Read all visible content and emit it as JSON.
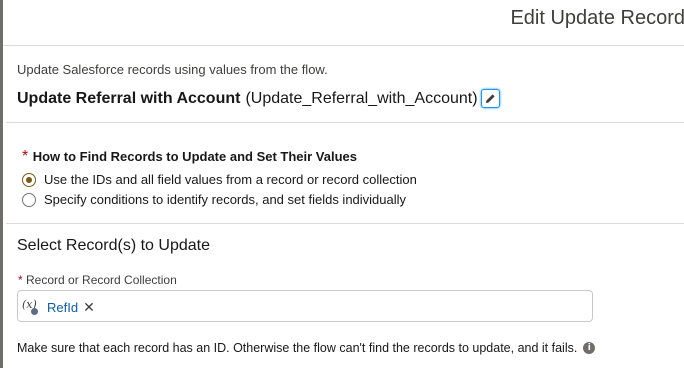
{
  "header": {
    "title": "Edit Update Record"
  },
  "element": {
    "description": "Update Salesforce records using values from the flow.",
    "label": "Update Referral with Account",
    "api_name": "(Update_Referral_with_Account)"
  },
  "find_records": {
    "required_mark": "*",
    "legend": "How to Find Records to Update and Set Their Values",
    "options": [
      {
        "label": "Use the IDs and all field values from a record or record collection",
        "selected": true
      },
      {
        "label": "Specify conditions to identify records, and set fields individually",
        "selected": false
      }
    ]
  },
  "select_records": {
    "title": "Select Record(s) to Update",
    "field": {
      "required_mark": "*",
      "label": "Record or Record Collection",
      "value_icon": "(x)",
      "value": "RefId",
      "remove_glyph": "✕"
    },
    "help_text": "Make sure that each record has an ID. Otherwise the flow can't find the records to update, and it fails.",
    "info_glyph": "i"
  },
  "colors": {
    "accent": "#1b96ff",
    "required": "#ba0517",
    "link": "#0b5cab",
    "radio": "#7a5a12"
  }
}
